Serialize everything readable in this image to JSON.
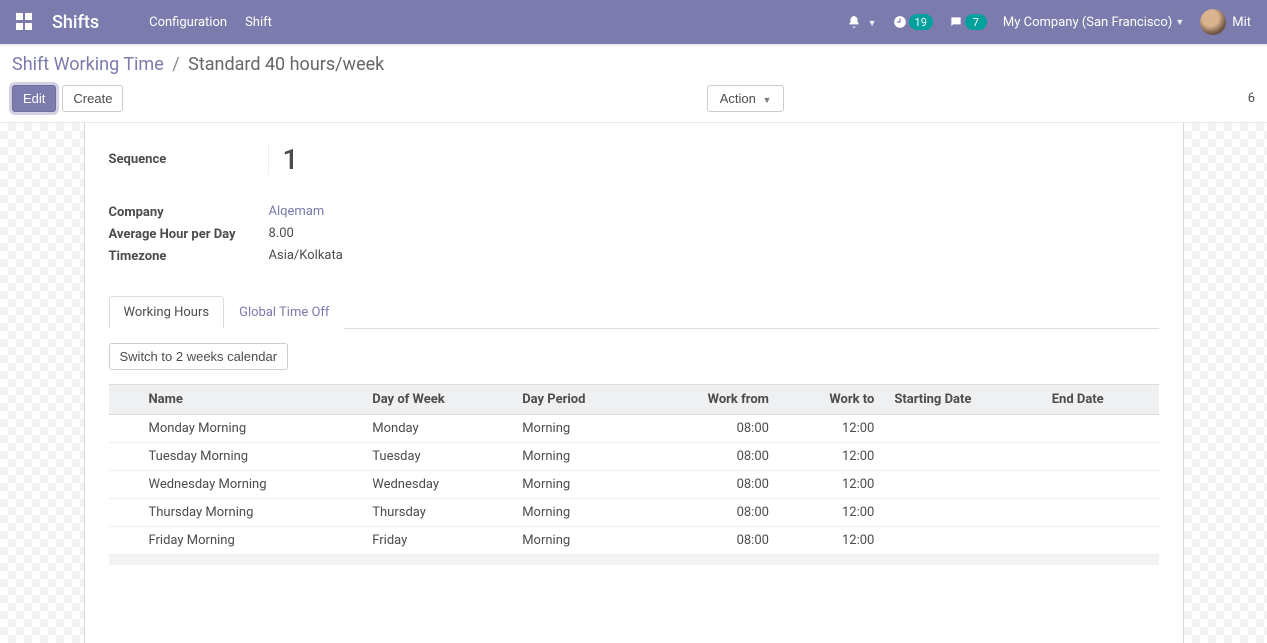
{
  "topbar": {
    "brand": "Shifts",
    "links": [
      "Configuration",
      "Shift"
    ],
    "clock_badge": "19",
    "chat_badge": "7",
    "company": "My Company (San Francisco)",
    "username": "Mit"
  },
  "breadcrumb": {
    "parent": "Shift Working Time",
    "current": "Standard 40 hours/week"
  },
  "buttons": {
    "edit": "Edit",
    "create": "Create",
    "action": "Action",
    "switch_weeks": "Switch to 2 weeks calendar"
  },
  "pager": {
    "text": "6"
  },
  "form": {
    "sequence_label": "Sequence",
    "sequence_value": "1",
    "company_label": "Company",
    "company_value": "Alqemam",
    "avg_label": "Average Hour per Day",
    "avg_value": "8.00",
    "tz_label": "Timezone",
    "tz_value": "Asia/Kolkata"
  },
  "tabs": {
    "working_hours": "Working Hours",
    "global_time_off": "Global Time Off"
  },
  "table": {
    "headers": {
      "name": "Name",
      "dow": "Day of Week",
      "period": "Day Period",
      "from": "Work from",
      "to": "Work to",
      "start": "Starting Date",
      "end": "End Date"
    },
    "rows": [
      {
        "name": "Monday Morning",
        "dow": "Monday",
        "period": "Morning",
        "from": "08:00",
        "to": "12:00",
        "start": "",
        "end": ""
      },
      {
        "name": "Tuesday Morning",
        "dow": "Tuesday",
        "period": "Morning",
        "from": "08:00",
        "to": "12:00",
        "start": "",
        "end": ""
      },
      {
        "name": "Wednesday Morning",
        "dow": "Wednesday",
        "period": "Morning",
        "from": "08:00",
        "to": "12:00",
        "start": "",
        "end": ""
      },
      {
        "name": "Thursday Morning",
        "dow": "Thursday",
        "period": "Morning",
        "from": "08:00",
        "to": "12:00",
        "start": "",
        "end": ""
      },
      {
        "name": "Friday Morning",
        "dow": "Friday",
        "period": "Morning",
        "from": "08:00",
        "to": "12:00",
        "start": "",
        "end": ""
      }
    ]
  }
}
